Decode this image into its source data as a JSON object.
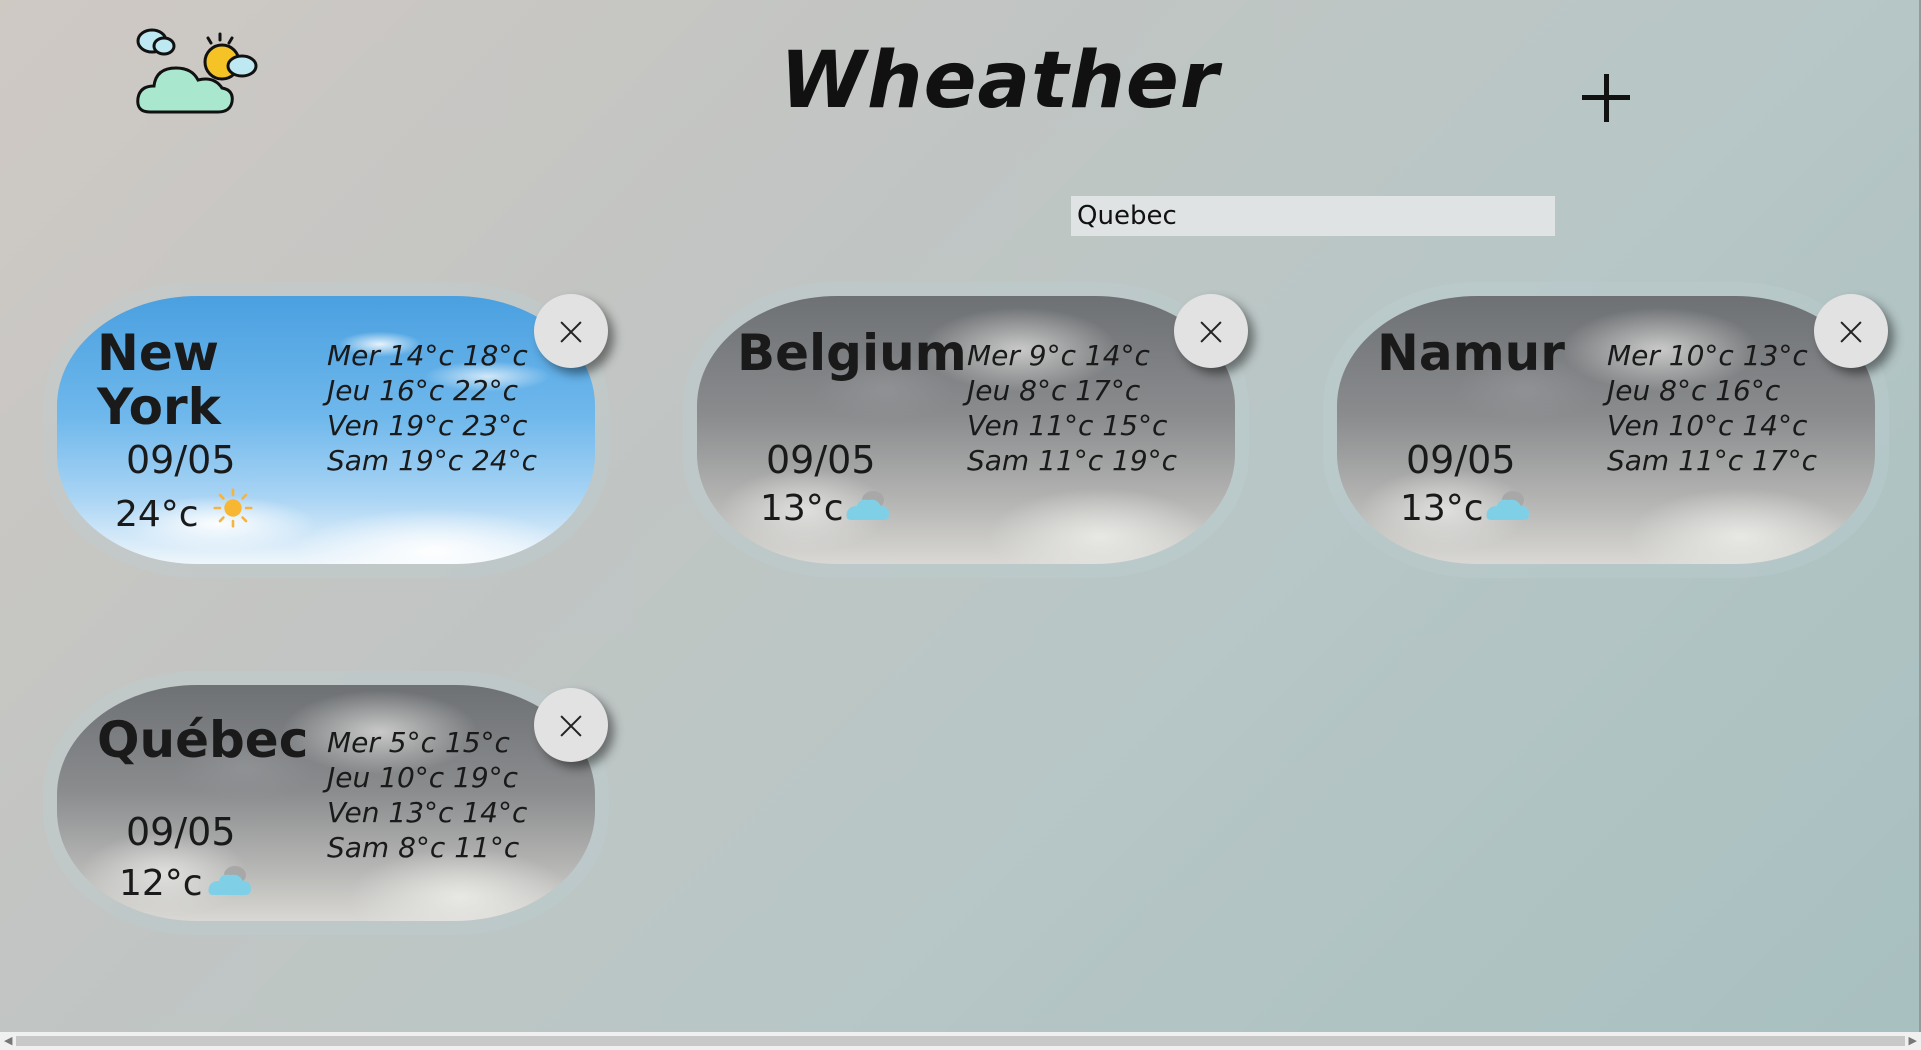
{
  "app": {
    "title": "Wheather"
  },
  "search": {
    "value": "Quebec"
  },
  "icons": {
    "logo": "sun-behind-cloud-icon",
    "add": "plus-icon",
    "close": "close-icon",
    "sunny": "sun-icon",
    "cloudy": "cloud-icon"
  },
  "cards": [
    {
      "city": "New York",
      "city_line1": "New",
      "city_line2": "York",
      "date": "09/05",
      "temp": "24°c",
      "condition": "sunny",
      "forecast": [
        "Mer 14°c 18°c",
        "Jeu 16°c 22°c",
        "Ven 19°c 23°c",
        "Sam 19°c 24°c"
      ]
    },
    {
      "city": "Belgium",
      "date": "09/05",
      "temp": "13°c",
      "condition": "cloudy",
      "forecast": [
        "Mer 9°c 14°c",
        "Jeu 8°c 17°c",
        "Ven 11°c 15°c",
        "Sam 11°c 19°c"
      ]
    },
    {
      "city": "Namur",
      "date": "09/05",
      "temp": "13°c",
      "condition": "cloudy",
      "forecast": [
        "Mer 10°c 13°c",
        "Jeu 8°c 16°c",
        "Ven 10°c 14°c",
        "Sam 11°c 17°c"
      ]
    },
    {
      "city": "Québec",
      "date": "09/05",
      "temp": "12°c",
      "condition": "cloudy",
      "forecast": [
        "Mer 5°c 15°c",
        "Jeu 10°c 19°c",
        "Ven 13°c 14°c",
        "Sam 8°c 11°c"
      ]
    }
  ],
  "colors": {
    "background_start": "#cfc9c4",
    "background_end": "#a8c0c0",
    "close_button": "#e2e2e2",
    "search_bg": "#dfe3e4"
  }
}
